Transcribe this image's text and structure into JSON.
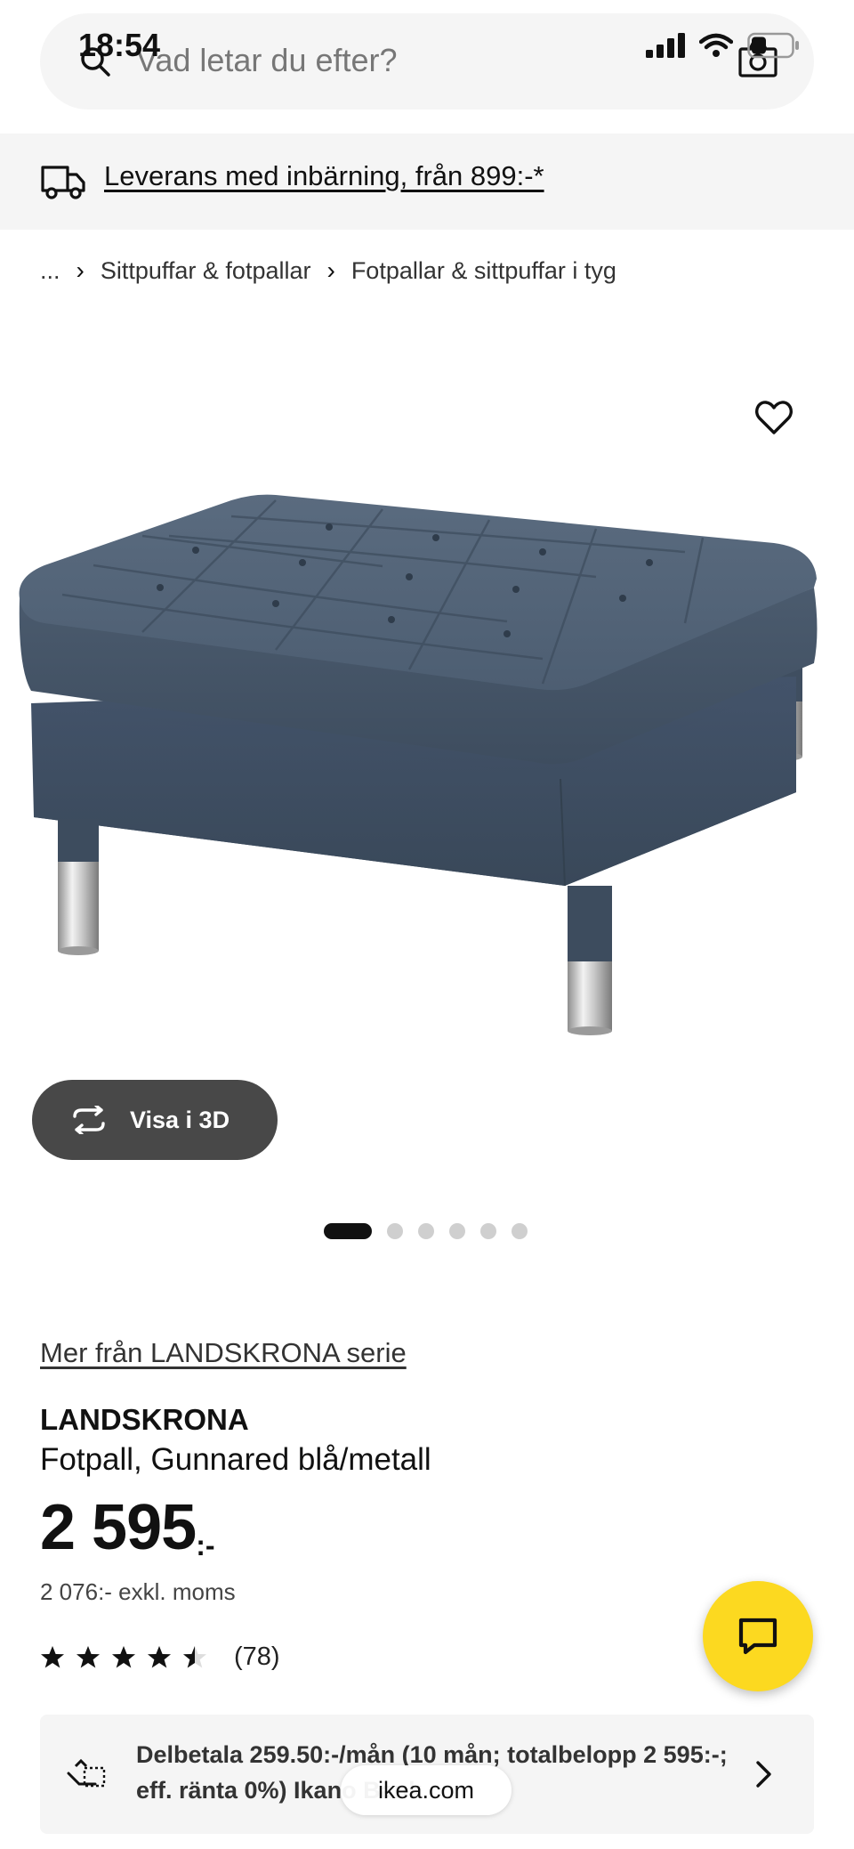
{
  "status_bar": {
    "time": "18:54"
  },
  "search": {
    "placeholder": "Vad letar du efter?"
  },
  "delivery": {
    "text": "Leverans med inbärning, från 899:-*"
  },
  "breadcrumb": {
    "ellipsis": "...",
    "items": [
      "Sittpuffar & fotpallar",
      "Fotpallar & sittpuffar i tyg"
    ]
  },
  "view_3d": {
    "label": "Visa i 3D"
  },
  "carousel": {
    "count": 6,
    "active_index": 0
  },
  "product": {
    "series_link": "Mer från LANDSKRONA serie",
    "name": "LANDSKRONA",
    "description": "Fotpall, Gunnared blå/metall",
    "price": "2 595",
    "price_suffix": ":-",
    "price_excl": "2 076:- exkl. moms",
    "rating": 4.5,
    "rating_max": 5,
    "review_count": "(78)"
  },
  "installment": {
    "text": "Delbetala 259.50:-/mån (10 mån; totalbelopp 2 595:-; eff. ränta 0%) Ikano Bank"
  },
  "browser": {
    "url": "ikea.com"
  },
  "colors": {
    "brand_yellow": "#fcd920",
    "panel_gray": "#f5f5f5",
    "button_dark": "#484848",
    "fabric_blue": "#4d5f73"
  },
  "icons": [
    "search-icon",
    "camera-icon",
    "truck-icon",
    "heart-icon",
    "rotate-3d-icon",
    "chat-icon",
    "installment-icon",
    "chevron-right-icon"
  ]
}
